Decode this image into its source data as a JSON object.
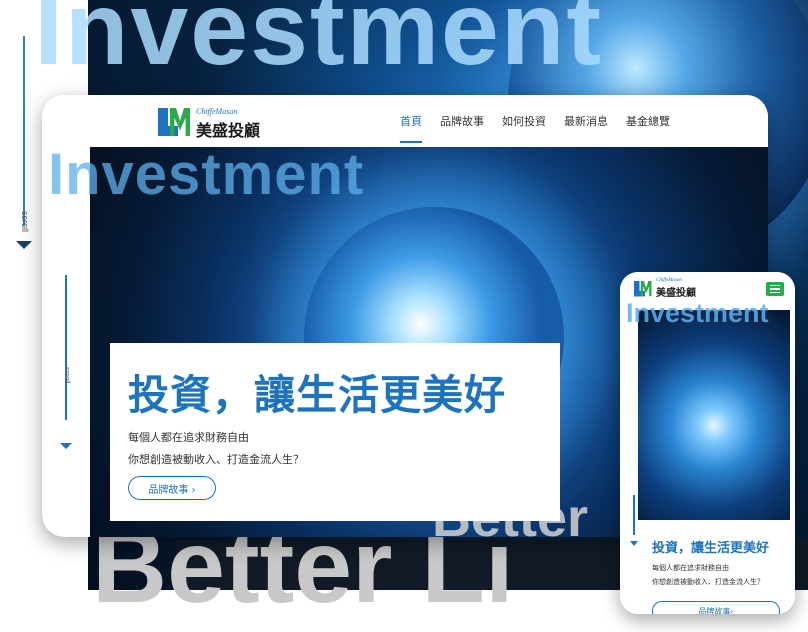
{
  "background": {
    "top_word": "Investment",
    "bottom_word": "Better Li"
  },
  "side_scroll": {
    "label": "scroll"
  },
  "desktop": {
    "logo": {
      "en": "ChiffeMason",
      "zh": "美盛投顧"
    },
    "nav": [
      {
        "label": "首頁",
        "active": true
      },
      {
        "label": "品牌故事",
        "active": false
      },
      {
        "label": "如何投資",
        "active": false
      },
      {
        "label": "最新消息",
        "active": false
      },
      {
        "label": "基金總覽",
        "active": false
      }
    ],
    "hero": {
      "bg_word": "Investment",
      "bottom_word": "Better",
      "scroll_label": "scroll",
      "title": "投資，讓生活更美好",
      "line1": "每個人都在追求財務自由",
      "line2": "你想創造被動收入、打造金流人生？",
      "button": "品牌故事 ›"
    }
  },
  "mobile": {
    "logo": {
      "en": "ChiffeMason",
      "zh": "美盛投顧"
    },
    "hero": {
      "bg_word": "Investment",
      "title": "投資，讓生活更美好",
      "line1": "每個人都在追求財務自由",
      "line2": "你想創造被動收入、打造金流人生？",
      "button": "品牌故事›"
    }
  },
  "colors": {
    "accent": "#1e73be",
    "brand_green": "#2ea84b"
  },
  "icons": [
    "menu-icon",
    "scroll-arrow-icon",
    "logo-mark-icon"
  ]
}
